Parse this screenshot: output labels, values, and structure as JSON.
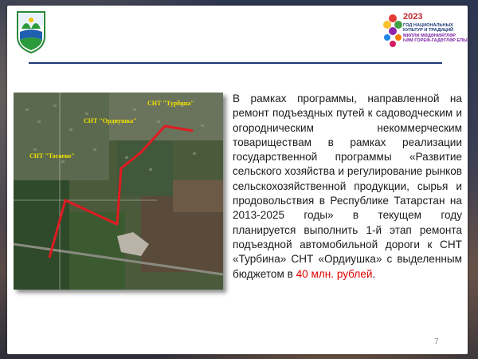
{
  "logo_right": {
    "year": "2023",
    "lines": [
      "ГОД НАЦИОНАЛЬНЫХ",
      "КУЛЬТУР И ТРАДИЦИЙ",
      "МИЛЛИ МӘДӘНИЯТЛӘР",
      "ҺӘМ ГОРЕФ-ГАДӘТЛӘР ЕЛЫ"
    ]
  },
  "map": {
    "labels": {
      "turbina": "СНТ \"Турбина\"",
      "ordiushka": "СНТ \"Ордиушка\"",
      "togaevo": "СНТ \"Тогаево\""
    },
    "route_color": "#e01b22"
  },
  "body": {
    "text": "В рамках программы, направленной на ремонт подъездных путей к садоводческим и огородническим некоммерческим товариществам в рамках реализации государственной программы «Развитие сельского хозяйства и регулирование рынков сельскохозяйственной продукции, сырья и продовольствия в Республике Татарстан на 2013-2025 годы» в текущем году планируется выполнить 1-й этап ремонта подъездной автомобильной дороги к СНТ «Турбина» СНТ «Ордиушка» с выделенным бюджетом в",
    "highlight": "40 млн. рублей",
    "end": "."
  },
  "page_number": "7"
}
